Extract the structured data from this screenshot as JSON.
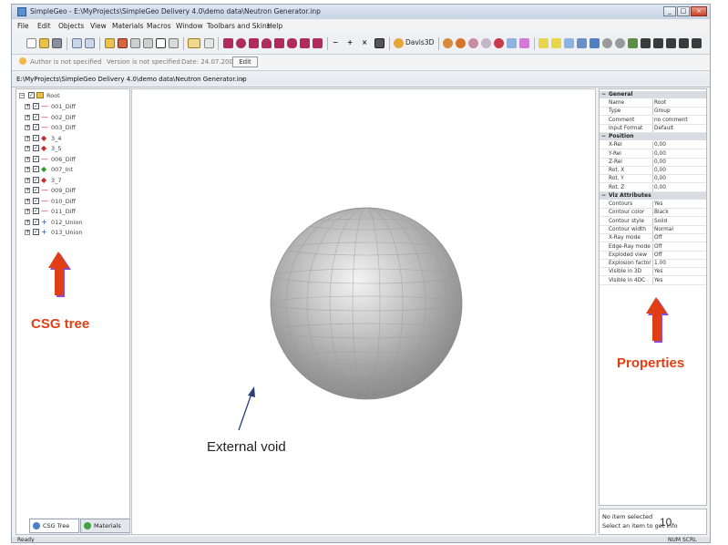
{
  "window": {
    "title": "SimpleGeo - E:\\MyProjects\\SimpleGeo Delivery 4.0\\demo data\\Neutron Generator.inp",
    "minimize": "_",
    "maximize": "□",
    "close": "×"
  },
  "menu": [
    "File",
    "Edit",
    "Objects",
    "View",
    "Materials",
    "Macros",
    "Window",
    "Toolbars and Skins",
    "Help"
  ],
  "toolbar": {
    "davis_label": "Davis3D"
  },
  "infobar": {
    "author": "Author is not specified",
    "version": "Version is not specified",
    "date": "Date: 24.07.2008",
    "button": "Edit"
  },
  "doc_tab": {
    "label": "E:\\MyProjects\\SimpleGeo Delivery 4.0\\demo data\\Neutron Generator.inp",
    "close": "×"
  },
  "tree": {
    "root": "Root",
    "items": [
      {
        "label": "001_Diff",
        "op": "—",
        "color": "#cc2a2a"
      },
      {
        "label": "002_Diff",
        "op": "—",
        "color": "#cc2a2a"
      },
      {
        "label": "003_Diff",
        "op": "—",
        "color": "#cc2a2a"
      },
      {
        "label": "3_4",
        "op": "◆",
        "color": "#cc2a2a"
      },
      {
        "label": "3_5",
        "op": "◆",
        "color": "#cc2a2a"
      },
      {
        "label": "006_Diff",
        "op": "—",
        "color": "#cc2a2a"
      },
      {
        "label": "007_Int",
        "op": "◆",
        "color": "#2a9a2a"
      },
      {
        "label": "3_7",
        "op": "◆",
        "color": "#cc2a2a"
      },
      {
        "label": "009_Diff",
        "op": "—",
        "color": "#cc2a2a"
      },
      {
        "label": "010_Diff",
        "op": "—",
        "color": "#cc2a2a"
      },
      {
        "label": "011_Diff",
        "op": "—",
        "color": "#cc2a2a"
      },
      {
        "label": "012_Union",
        "op": "+",
        "color": "#2a46c4"
      },
      {
        "label": "013_Union",
        "op": "+",
        "color": "#2a46c4"
      }
    ]
  },
  "panel_tabs": {
    "csg": "CSG Tree",
    "materials": "Materials"
  },
  "properties": {
    "categories": [
      {
        "name": "General",
        "rows": [
          {
            "name": "Name",
            "value": "Root"
          },
          {
            "name": "Type",
            "value": "Group"
          },
          {
            "name": "Comment",
            "value": "no comment"
          },
          {
            "name": "Input Format",
            "value": "Default"
          }
        ]
      },
      {
        "name": "Position",
        "rows": [
          {
            "name": "X-Rel",
            "value": "0,00"
          },
          {
            "name": "Y-Rel",
            "value": "0,00"
          },
          {
            "name": "Z-Rel",
            "value": "0,00"
          },
          {
            "name": "Rot. X",
            "value": "0,00"
          },
          {
            "name": "Rot. Y",
            "value": "0,00"
          },
          {
            "name": "Rot. Z",
            "value": "0,00"
          }
        ]
      },
      {
        "name": "Viz Attributes",
        "rows": [
          {
            "name": "Contours",
            "value": "Yes"
          },
          {
            "name": "Contour color",
            "value": "Black"
          },
          {
            "name": "Contour style",
            "value": "Solid"
          },
          {
            "name": "Contour width",
            "value": "Normal"
          },
          {
            "name": "X-Ray mode",
            "value": "Off"
          },
          {
            "name": "Edge-Ray mode",
            "value": "Off"
          },
          {
            "name": "Exploded view",
            "value": "Off"
          },
          {
            "name": "Explosion factor",
            "value": "1.00"
          },
          {
            "name": "Visible in 3D",
            "value": "Yes"
          },
          {
            "name": "Visible in 4DC",
            "value": "Yes"
          }
        ]
      }
    ]
  },
  "description": {
    "line1": "No item selected",
    "line2": "Select an item to get info"
  },
  "status": {
    "left": "Ready",
    "right": "NUM  SCRL"
  },
  "annotations": {
    "csg_tree": "CSG tree",
    "properties": "Properties",
    "external_void": "External void",
    "page_number": "10"
  },
  "colors": {
    "annotation_red": "#e03e14",
    "sphere_gray": "#b8b8b8"
  }
}
